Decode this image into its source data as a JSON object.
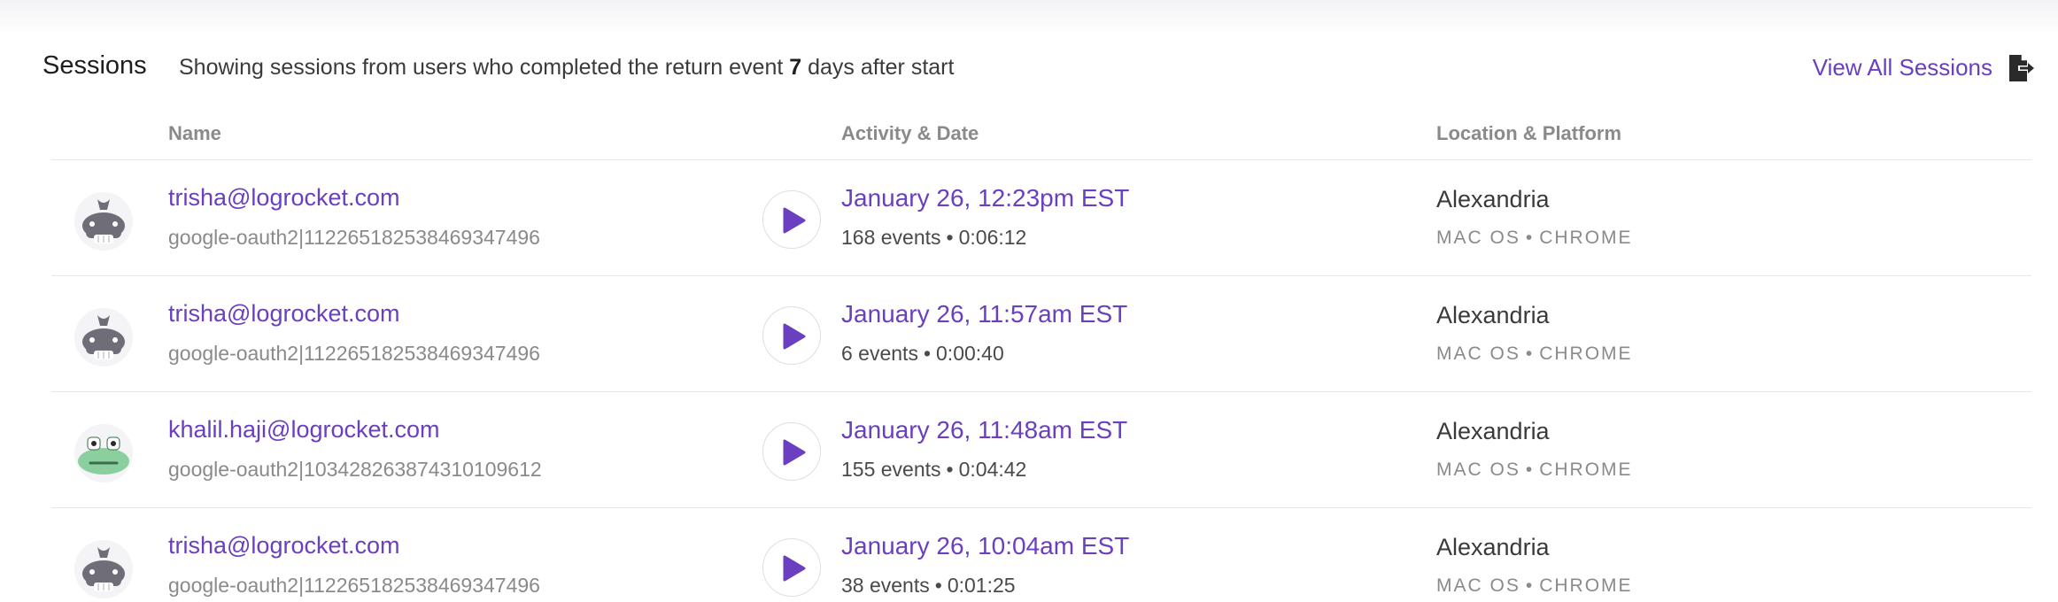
{
  "header": {
    "title": "Sessions",
    "subtitle_prefix": "Showing sessions from users who completed the return event",
    "subtitle_days": "7",
    "subtitle_suffix": "days after start",
    "view_all_label": "View All Sessions",
    "export_icon": "export-icon"
  },
  "columns": {
    "name": "Name",
    "activity": "Activity & Date",
    "location": "Location & Platform"
  },
  "colors": {
    "accent": "#6a3fc0",
    "muted": "#8a8a8a"
  },
  "sessions": [
    {
      "avatar": "whale-avatar",
      "email": "trisha@logrocket.com",
      "user_id": "google-oauth2|112265182538469347496",
      "date": "January 26, 12:23pm EST",
      "events": "168 events",
      "duration": "0:06:12",
      "location": "Alexandria",
      "os": "MAC OS",
      "browser": "CHROME"
    },
    {
      "avatar": "whale-avatar",
      "email": "trisha@logrocket.com",
      "user_id": "google-oauth2|112265182538469347496",
      "date": "January 26, 11:57am EST",
      "events": "6 events",
      "duration": "0:00:40",
      "location": "Alexandria",
      "os": "MAC OS",
      "browser": "CHROME"
    },
    {
      "avatar": "frog-avatar",
      "email": "khalil.haji@logrocket.com",
      "user_id": "google-oauth2|103428263874310109612",
      "date": "January 26, 11:48am EST",
      "events": "155 events",
      "duration": "0:04:42",
      "location": "Alexandria",
      "os": "MAC OS",
      "browser": "CHROME"
    },
    {
      "avatar": "whale-avatar",
      "email": "trisha@logrocket.com",
      "user_id": "google-oauth2|112265182538469347496",
      "date": "January 26, 10:04am EST",
      "events": "38 events",
      "duration": "0:01:25",
      "location": "Alexandria",
      "os": "MAC OS",
      "browser": "CHROME"
    }
  ]
}
